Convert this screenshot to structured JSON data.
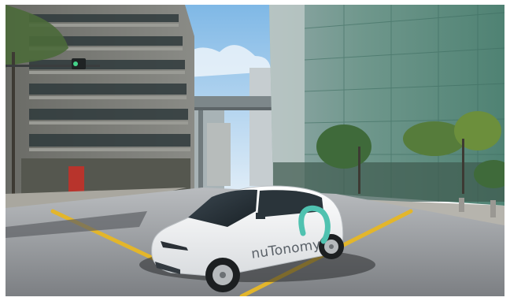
{
  "photo": {
    "subject": "self-driving-car-on-city-street",
    "colors": {
      "sky_top": "#7fb8e6",
      "sky_bottom": "#dbeaf6",
      "road": "#8f9296",
      "road_markings": "#e3b62b",
      "car_body": "#f4f5f6",
      "logo_teal": "#4fc2b0",
      "glass_building": "#5e8f7f"
    },
    "car": {
      "brand_text": "nuTonomy"
    }
  }
}
